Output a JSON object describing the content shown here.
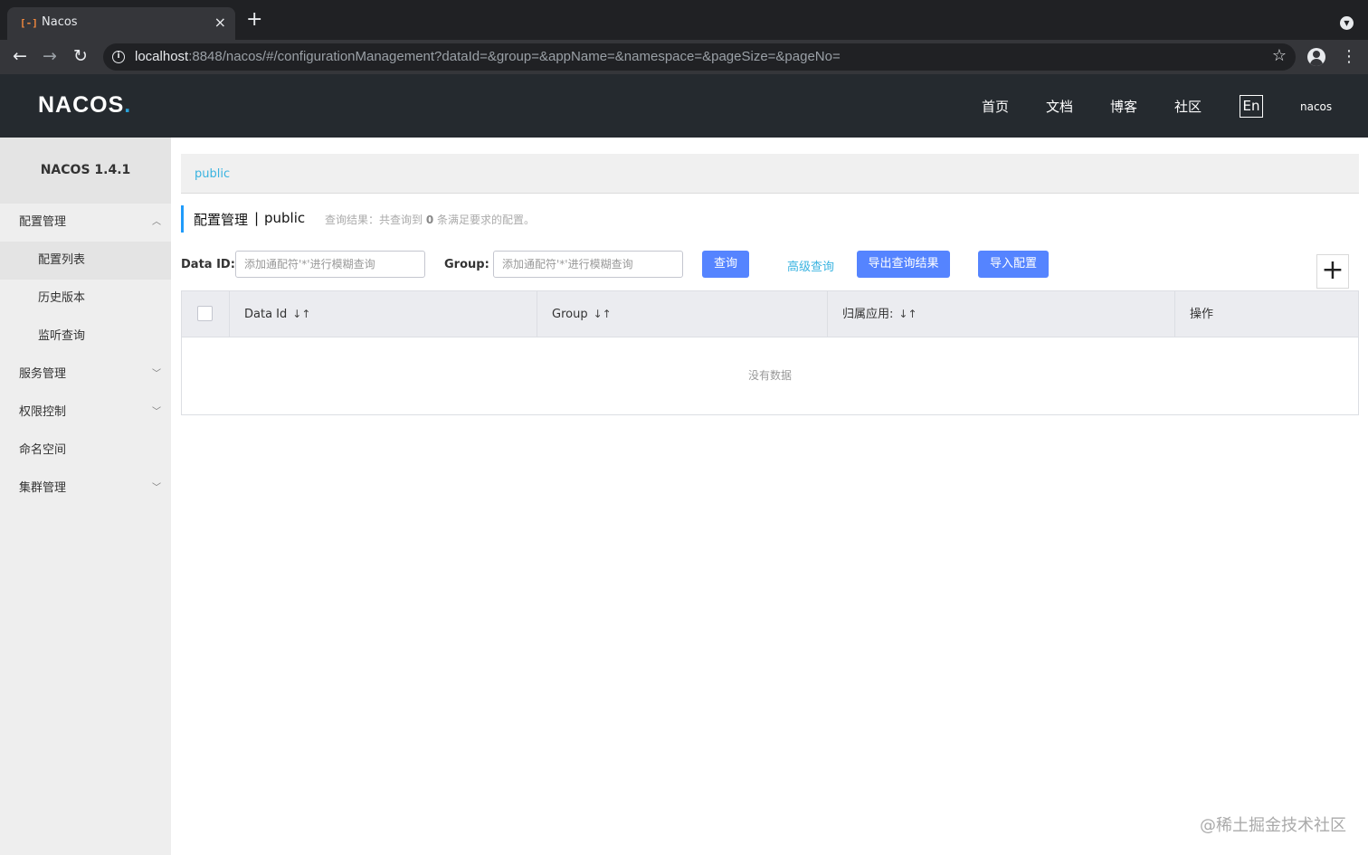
{
  "browser": {
    "tab_title": "Nacos",
    "tab_favicon": "nacos-logo-icon",
    "close_glyph": "×",
    "newtab_glyph": "+",
    "url_host": "localhost",
    "url_rest": ":8848/nacos/#/configurationManagement?dataId=&group=&appName=&namespace=&pageSize=&pageNo="
  },
  "header": {
    "logo_main": "NACOS",
    "logo_dot": ".",
    "nav": [
      "首页",
      "文档",
      "博客",
      "社区"
    ],
    "lang": "En",
    "user": "nacos"
  },
  "sidebar": {
    "title": "NACOS 1.4.1",
    "items": [
      {
        "label": "配置管理",
        "chevron": "up"
      },
      {
        "label": "配置列表",
        "sub": true,
        "active": true
      },
      {
        "label": "历史版本",
        "sub": true
      },
      {
        "label": "监听查询",
        "sub": true
      },
      {
        "label": "服务管理",
        "chevron": "down"
      },
      {
        "label": "权限控制",
        "chevron": "down"
      },
      {
        "label": "命名空间"
      },
      {
        "label": "集群管理",
        "chevron": "down"
      }
    ]
  },
  "breadcrumb": {
    "namespace": "public"
  },
  "title": {
    "main": "配置管理",
    "sep": "|",
    "namespace": "public",
    "result_prefix": "查询结果：共查询到",
    "result_count": "0",
    "result_suffix": "条满足要求的配置。"
  },
  "filters": {
    "data_id_label": "Data ID:",
    "data_id_placeholder": "添加通配符'*'进行模糊查询",
    "group_label": "Group:",
    "group_placeholder": "添加通配符'*'进行模糊查询",
    "query_button": "查询",
    "advanced_query": "高级查询",
    "export_button": "导出查询结果",
    "import_button": "导入配置",
    "add_glyph": "+"
  },
  "table": {
    "columns": [
      "Data Id",
      "Group",
      "归属应用:",
      "操作"
    ],
    "sort_glyph": "↓↑",
    "empty_text": "没有数据"
  },
  "watermark": "@稀土掘金技术社区",
  "colors": {
    "accent": "#5584ff",
    "link": "#39b3e0",
    "header_bg": "#252a2f",
    "sidebar_bg": "#eeeeee"
  }
}
